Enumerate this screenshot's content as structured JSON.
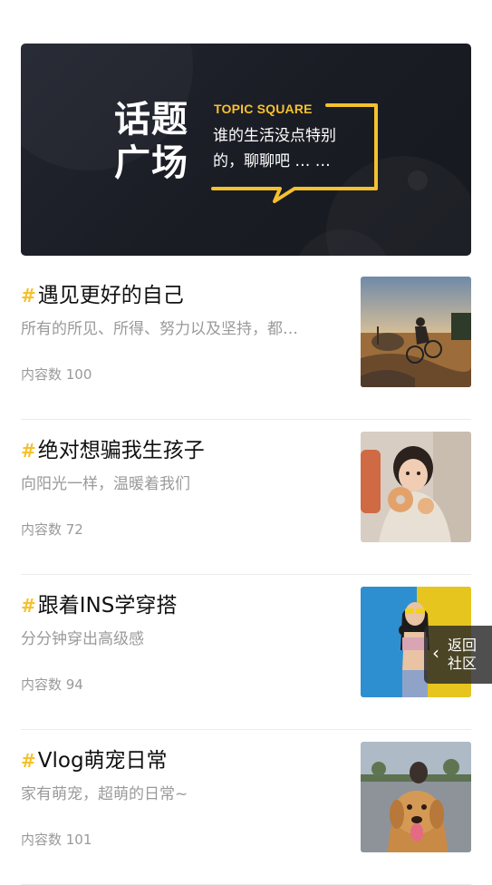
{
  "banner": {
    "title_line1": "话题",
    "title_line2": "广场",
    "subtitle_en": "TOPIC SQUARE",
    "subtitle_line1": "谁的生活没点特别",
    "subtitle_line2": "的，聊聊吧 … …"
  },
  "topics": [
    {
      "hash": "#",
      "title": "遇见更好的自己",
      "desc": "所有的所见、所得、努力以及坚持，都…",
      "count": "内容数 100",
      "image": "cyclist-sunset-photo"
    },
    {
      "hash": "#",
      "title": "绝对想骗我生孩子",
      "desc": "向阳光一样，温暖着我们",
      "count": "内容数 72",
      "image": "child-donut-photo"
    },
    {
      "hash": "#",
      "title": "跟着INS学穿搭",
      "desc": "分分钟穿出高级感",
      "count": "内容数 94",
      "image": "fashion-girl-photo"
    },
    {
      "hash": "#",
      "title": "Vlog萌宠日常",
      "desc": "家有萌宠，超萌的日常~",
      "count": "内容数 101",
      "image": "golden-retriever-photo"
    }
  ],
  "float_button": {
    "line1": "返回",
    "line2": "社区"
  },
  "colors": {
    "accent": "#f5c12e",
    "banner_bg": "#1c1e26",
    "text_primary": "#111111",
    "text_secondary": "#9a9a9a"
  }
}
